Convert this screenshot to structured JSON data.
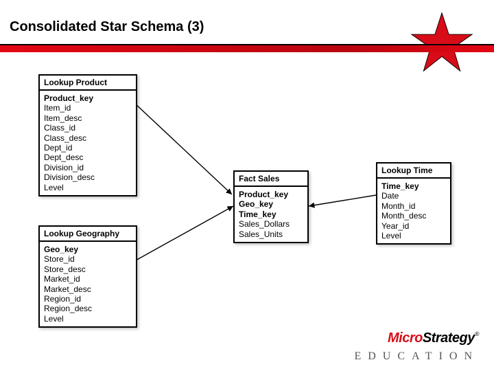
{
  "title": "Consolidated Star Schema (3)",
  "entities": {
    "product": {
      "header": "Lookup Product",
      "fields": {
        "k0": "Product_key",
        "f1": "Item_id",
        "f2": "Item_desc",
        "f3": "Class_id",
        "f4": "Class_desc",
        "f5": "Dept_id",
        "f6": "Dept_desc",
        "f7": "Division_id",
        "f8": "Division_desc",
        "f9": "Level"
      }
    },
    "geography": {
      "header": "Lookup Geography",
      "fields": {
        "k0": "Geo_key",
        "f1": "Store_id",
        "f2": "Store_desc",
        "f3": "Market_id",
        "f4": "Market_desc",
        "f5": "Region_id",
        "f6": "Region_desc",
        "f7": "Level"
      }
    },
    "fact": {
      "header": "Fact Sales",
      "fields": {
        "k0": "Product_key",
        "k1": "Geo_key",
        "k2": "Time_key",
        "f3": "Sales_Dollars",
        "f4": "Sales_Units"
      }
    },
    "time": {
      "header": "Lookup Time",
      "fields": {
        "k0": "Time_key",
        "f1": "Date",
        "f2": "Month_id",
        "f3": "Month_desc",
        "f4": "Year_id",
        "f5": "Level"
      }
    }
  },
  "logo": {
    "brand_left": "Micro",
    "brand_right": "Strategy",
    "reg": "®",
    "tagline": "EDUCATION"
  },
  "colors": {
    "accent_red": "#d80c18",
    "band_red": "#e30613"
  }
}
